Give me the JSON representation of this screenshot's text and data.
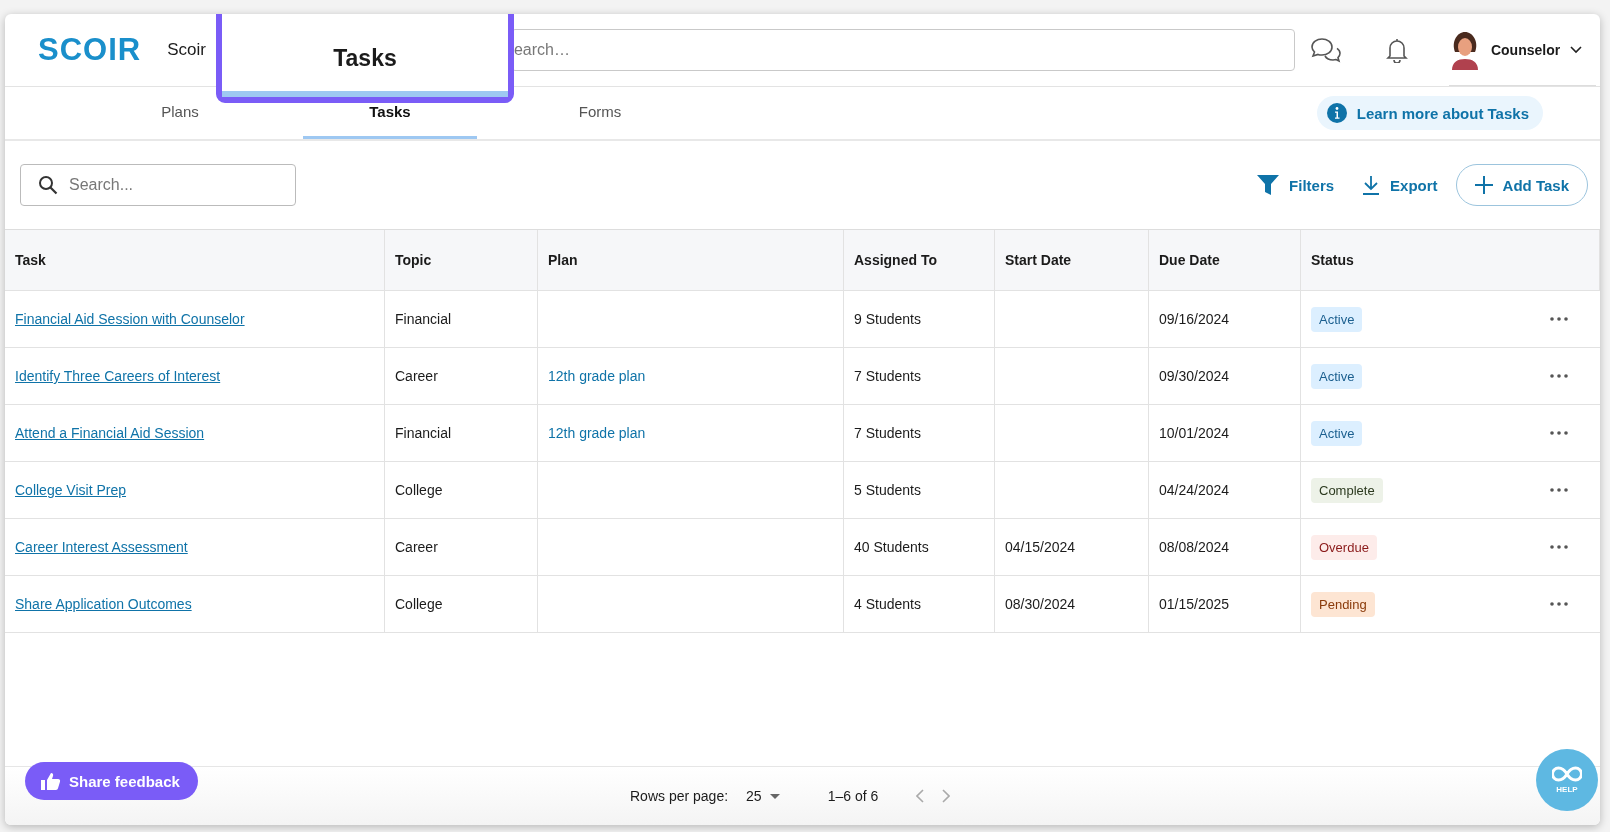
{
  "header": {
    "logo": "SCOIR",
    "school": "Scoir",
    "search": {
      "placeholder": "earch…"
    },
    "user": "Counselor"
  },
  "callout": {
    "label": "Tasks"
  },
  "tabs": [
    {
      "label": "Plans",
      "selected": false
    },
    {
      "label": "Tasks",
      "selected": true
    },
    {
      "label": "Forms",
      "selected": false
    }
  ],
  "learn_more": "Learn more about Tasks",
  "toolbar": {
    "search": {
      "placeholder": "Search..."
    },
    "filters": "Filters",
    "export": "Export",
    "add": "Add Task"
  },
  "table": {
    "columns": [
      "Task",
      "Topic",
      "Plan",
      "Assigned To",
      "Start Date",
      "Due Date",
      "Status"
    ],
    "rows": [
      {
        "task": "Financial Aid Session with Counselor",
        "topic": "Financial",
        "plan": "",
        "assigned": "9 Students",
        "start": "",
        "due": "09/16/2024",
        "status": "Active",
        "kind": "active"
      },
      {
        "task": "Identify Three Careers of Interest",
        "topic": "Career",
        "plan": "12th grade plan",
        "assigned": "7 Students",
        "start": "",
        "due": "09/30/2024",
        "status": "Active",
        "kind": "active"
      },
      {
        "task": "Attend a Financial Aid Session",
        "topic": "Financial",
        "plan": "12th grade plan",
        "assigned": "7 Students",
        "start": "",
        "due": "10/01/2024",
        "status": "Active",
        "kind": "active"
      },
      {
        "task": "College Visit Prep",
        "topic": "College",
        "plan": "",
        "assigned": "5 Students",
        "start": "",
        "due": "04/24/2024",
        "status": "Complete",
        "kind": "complete"
      },
      {
        "task": "Career Interest Assessment",
        "topic": "Career",
        "plan": "",
        "assigned": "40 Students",
        "start": "04/15/2024",
        "due": "08/08/2024",
        "status": "Overdue",
        "kind": "overdue"
      },
      {
        "task": "Share Application Outcomes",
        "topic": "College",
        "plan": "",
        "assigned": "4 Students",
        "start": "08/30/2024",
        "due": "01/15/2025",
        "status": "Pending",
        "kind": "pending"
      }
    ]
  },
  "footer": {
    "feedback": "Share feedback",
    "rows_label": "Rows per page:",
    "rows_value": "25",
    "range": "1–6 of 6",
    "help": "HELP"
  }
}
